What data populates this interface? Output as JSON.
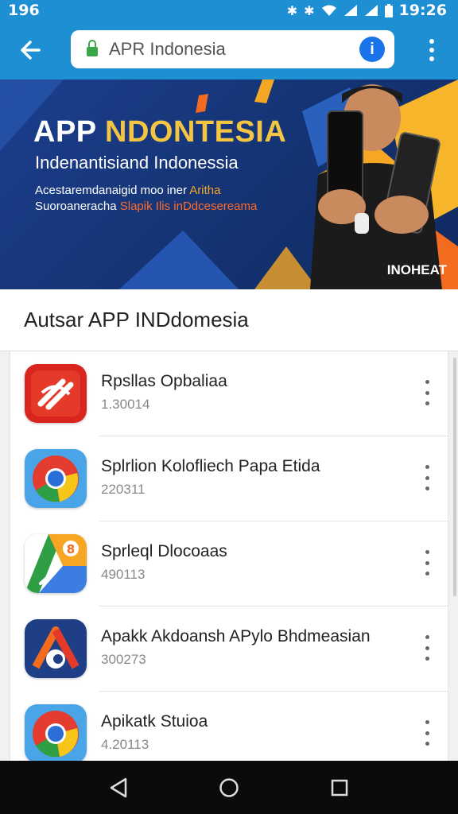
{
  "status_bar": {
    "time_left": "196",
    "time_right": "19:26"
  },
  "toolbar": {
    "url": "APR Indonesia",
    "info_label": "i"
  },
  "banner": {
    "title_main": "APP ",
    "title_accent": "NDONTESIA",
    "subtitle": "Indenantisiand Indonessia",
    "line1": "Acestaremdanaigid moo iner ",
    "line1_hl": "Aritha",
    "line2": "Suoroaneracha ",
    "line2_hl": "Slapik Ilis inDdcesereama",
    "badge": "INOHEAT"
  },
  "section": {
    "title": "Autsar APP INDdomesia"
  },
  "apps": [
    {
      "name": "Rpsllas Opbaliaa",
      "meta": "1.30014"
    },
    {
      "name": "Splrlion Kolofliech Papa Etida",
      "meta": "220311"
    },
    {
      "name": "Sprleql Dlocoaas",
      "meta": "490113"
    },
    {
      "name": "Apakk Akdoansh APylo Bhdmeasian",
      "meta": "300273"
    },
    {
      "name": "Apikatk Stuioa",
      "meta": "4.20113"
    }
  ],
  "colors": {
    "accent": "#1f8fd3",
    "nav": "#0b0b0b"
  }
}
